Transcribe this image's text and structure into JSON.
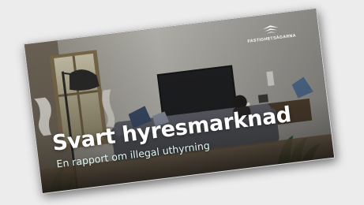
{
  "report": {
    "brand": "FASTIGHETSÄGARNA",
    "title": "Svart hyresmarknad",
    "subtitle": "En rapport om illegal uthyrning"
  },
  "colors": {
    "background": "#ececed",
    "title_text": "#ffffff",
    "subtitle_text": "#dff7ef"
  }
}
